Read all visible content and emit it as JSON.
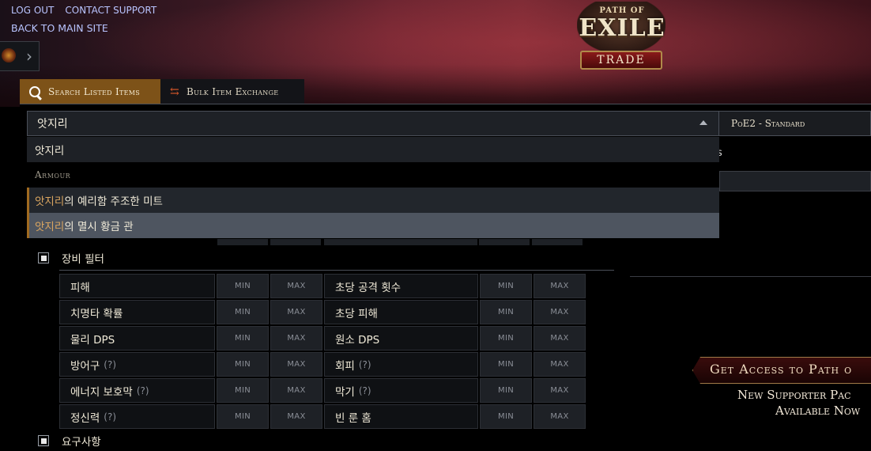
{
  "top_links": {
    "logout": "LOG OUT",
    "support": "CONTACT SUPPORT",
    "back": "BACK TO MAIN SITE"
  },
  "logo": {
    "path_of": "PATH OF",
    "exile": "EXILE",
    "trade": "TRADE"
  },
  "tabs": [
    {
      "label": "Search Listed Items",
      "active": true,
      "icon": "search-icon"
    },
    {
      "label": "Bulk Item Exchange",
      "active": false,
      "icon": "exchange-icon"
    }
  ],
  "search": {
    "value": "앗지리"
  },
  "league": {
    "value": "PoE2 - Standard"
  },
  "dropdown": {
    "first_item": "앗지리",
    "header": "Armour",
    "options": [
      {
        "match": "앗지리",
        "rest": "의 예리함 주조한 미트",
        "highlighted": false
      },
      {
        "match": "앗지리",
        "rest": "의 멸시 황금 관",
        "highlighted": true
      }
    ]
  },
  "behind": {
    "partial_text": "s"
  },
  "equipment_filters": {
    "title": "장비 필터",
    "min_placeholder": "MIN",
    "max_placeholder": "MAX",
    "rows": [
      {
        "left": "피해",
        "left_help": "",
        "right": "초당 공격 횟수",
        "right_help": ""
      },
      {
        "left": "치명타 확률",
        "left_help": "",
        "right": "초당 피해",
        "right_help": ""
      },
      {
        "left": "물리 DPS",
        "left_help": "",
        "right": "원소 DPS",
        "right_help": ""
      },
      {
        "left": "방어구",
        "left_help": "(?)",
        "right": "회피",
        "right_help": "(?)"
      },
      {
        "left": "에너지 보호막",
        "left_help": "(?)",
        "right": "막기",
        "right_help": "(?)"
      },
      {
        "left": "정신력",
        "left_help": "(?)",
        "right": "빈 룬 홈",
        "right_help": ""
      }
    ]
  },
  "requirements": {
    "title": "요구사항"
  },
  "ad": {
    "title": "Get Access to Path o",
    "line1": "New Supporter Pac",
    "line2": "Available Now"
  }
}
